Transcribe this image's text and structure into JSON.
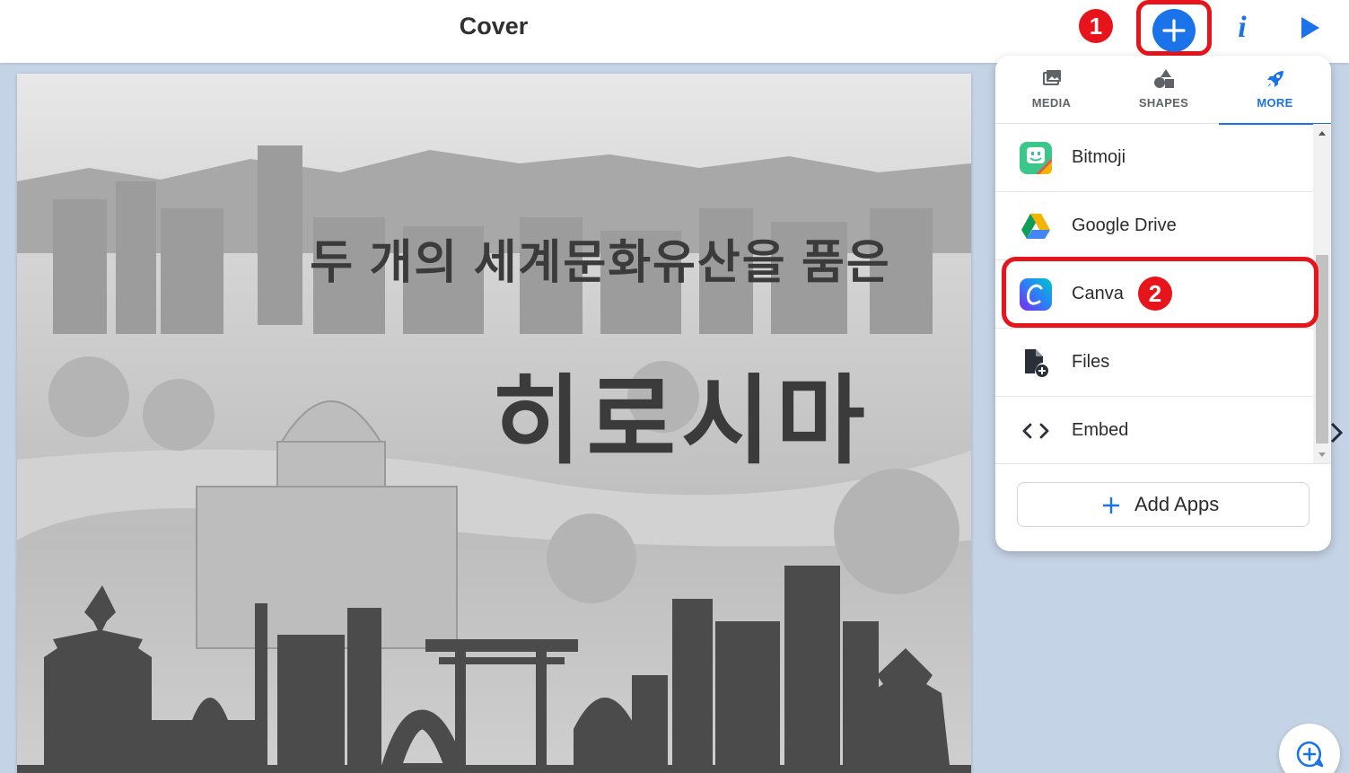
{
  "header": {
    "title": "Cover",
    "add_icon": "plus-icon",
    "info_icon": "info-icon",
    "info_glyph": "i",
    "play_icon": "play-icon"
  },
  "annotations": {
    "step1": "1",
    "step2": "2",
    "highlight_color": "#e8141c"
  },
  "cover": {
    "subtitle": "두 개의 세계문화유산을 품은",
    "title": "히로시마"
  },
  "panel": {
    "tabs": [
      {
        "label": "MEDIA",
        "icon": "media-icon",
        "active": false
      },
      {
        "label": "SHAPES",
        "icon": "shapes-icon",
        "active": false
      },
      {
        "label": "MORE",
        "icon": "rocket-icon",
        "active": true
      }
    ],
    "items": [
      {
        "label": "Bitmoji",
        "icon": "bitmoji-icon"
      },
      {
        "label": "Google Drive",
        "icon": "google-drive-icon"
      },
      {
        "label": "Canva",
        "icon": "canva-icon"
      },
      {
        "label": "Files",
        "icon": "file-add-icon"
      },
      {
        "label": "Embed",
        "icon": "code-icon"
      }
    ],
    "add_apps": "Add Apps"
  },
  "colors": {
    "accent": "#1a73e8",
    "background": "#c5d3e6"
  }
}
